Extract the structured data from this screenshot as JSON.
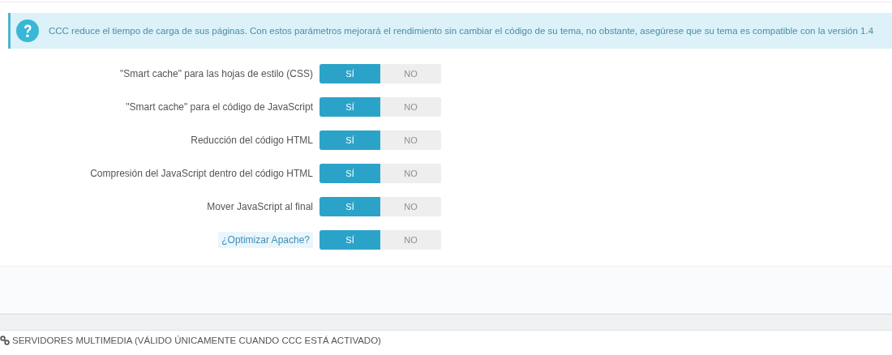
{
  "alert": {
    "text": "CCC reduce el tiempo de carga de sus páginas. Con estos parámetros mejorará el rendimiento sin cambiar el código de su tema, no obstante, asegúrese que su tema es compatible con la versión 1.4"
  },
  "settings": [
    {
      "label": "\"Smart cache\" para las hojas de estilo (CSS)",
      "kind": "plain",
      "options": [
        {
          "label": "SÍ",
          "selected": true
        },
        {
          "label": "NO",
          "selected": false
        }
      ]
    },
    {
      "label": "\"Smart cache\" para el código de JavaScript",
      "kind": "plain",
      "options": [
        {
          "label": "SÍ",
          "selected": true
        },
        {
          "label": "NO",
          "selected": false
        }
      ]
    },
    {
      "label": "Reducción del código HTML",
      "kind": "plain",
      "options": [
        {
          "label": "SÍ",
          "selected": true
        },
        {
          "label": "NO",
          "selected": false
        }
      ]
    },
    {
      "label": "Compresión del JavaScript dentro del código HTML",
      "kind": "plain",
      "options": [
        {
          "label": "SÍ",
          "selected": true
        },
        {
          "label": "NO",
          "selected": false
        }
      ]
    },
    {
      "label": "Mover JavaScript al final",
      "kind": "plain",
      "options": [
        {
          "label": "SÍ",
          "selected": true
        },
        {
          "label": "NO",
          "selected": false
        }
      ]
    },
    {
      "label": "¿Optimizar Apache?",
      "kind": "help",
      "options": [
        {
          "label": "SÍ",
          "selected": true
        },
        {
          "label": "NO",
          "selected": false
        }
      ]
    }
  ],
  "next_section": {
    "title": "SERVIDORES MULTIMEDIA (VÁLIDO ÚNICAMENTE CUANDO CCC ESTÁ ACTIVADO)"
  }
}
